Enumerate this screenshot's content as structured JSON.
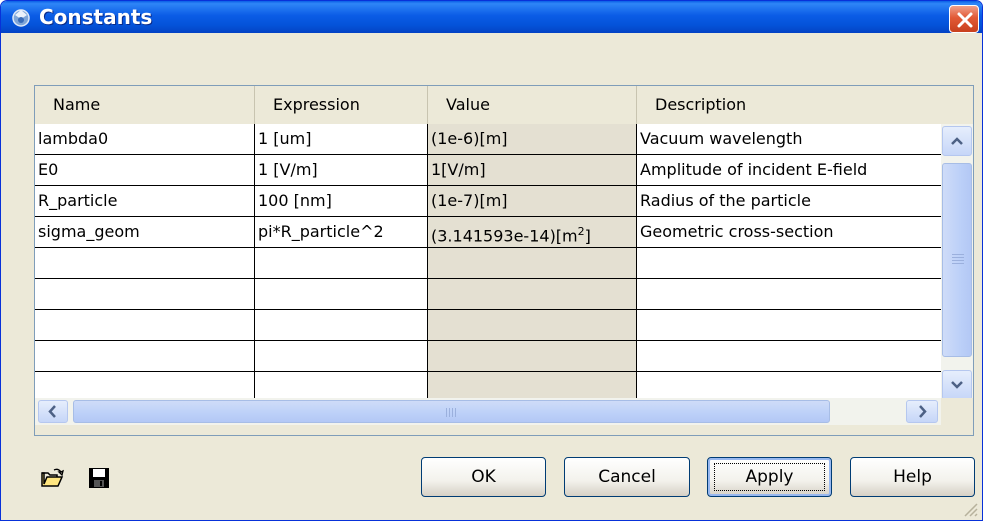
{
  "window": {
    "title": "Constants",
    "colors": {
      "titlebar": "#0a5fe7",
      "close": "#e25a36",
      "face": "#ece9d8"
    }
  },
  "grid": {
    "columns": [
      "Name",
      "Expression",
      "Value",
      "Description"
    ],
    "rows": [
      {
        "name": "lambda0",
        "expression": "1 [um]",
        "value": "(1e-6)[m]",
        "description": "Vacuum wavelength"
      },
      {
        "name": "E0",
        "expression": "1 [V/m]",
        "value": "1[V/m]",
        "description": "Amplitude of incident E-field"
      },
      {
        "name": "R_particle",
        "expression": "100 [nm]",
        "value": "(1e-7)[m]",
        "description": "Radius of the particle"
      },
      {
        "name": "sigma_geom",
        "expression": "pi*R_particle^2",
        "value": "(3.141593e-14)[m",
        "value_sup": "2",
        "value_suffix": "]",
        "description": "Geometric cross-section"
      },
      {
        "name": "",
        "expression": "",
        "value": "",
        "description": ""
      },
      {
        "name": "",
        "expression": "",
        "value": "",
        "description": ""
      },
      {
        "name": "",
        "expression": "",
        "value": "",
        "description": ""
      },
      {
        "name": "",
        "expression": "",
        "value": "",
        "description": ""
      },
      {
        "name": "",
        "expression": "",
        "value": "",
        "description": ""
      }
    ]
  },
  "toolbar": {
    "open_icon": "folder-open-icon",
    "save_icon": "floppy-disk-icon"
  },
  "buttons": {
    "ok": "OK",
    "cancel": "Cancel",
    "apply": "Apply",
    "help": "Help"
  }
}
